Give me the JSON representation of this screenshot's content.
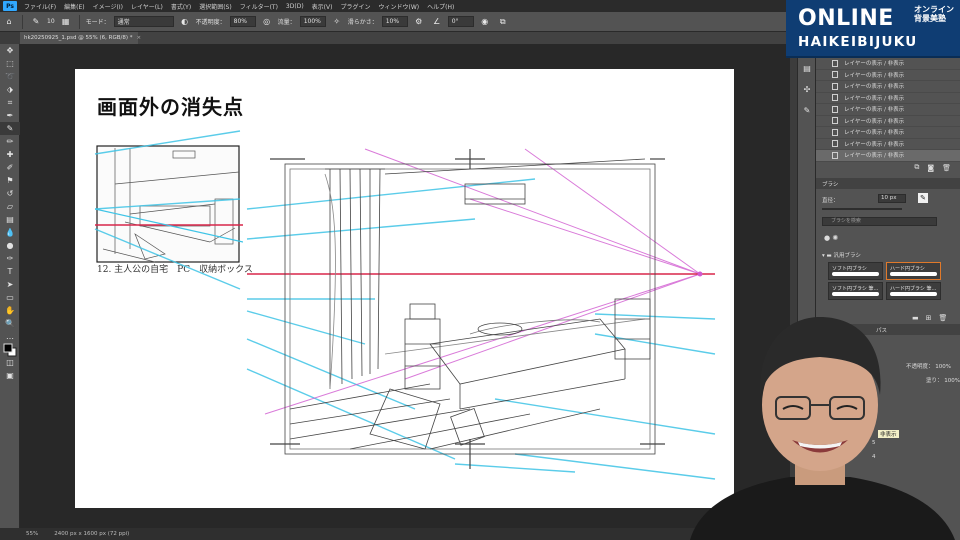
{
  "menu": {
    "app_icon": "Ps",
    "items": [
      "ファイル(F)",
      "編集(E)",
      "イメージ(I)",
      "レイヤー(L)",
      "書式(Y)",
      "選択範囲(S)",
      "フィルター(T)",
      "3D(D)",
      "表示(V)",
      "プラグイン",
      "ウィンドウ(W)",
      "ヘルプ(H)"
    ]
  },
  "options": {
    "brush_size": "10",
    "mode_label": "モード：",
    "mode_value": "通常",
    "opacity_label": "不透明度：",
    "opacity_value": "80%",
    "flow_label": "流量：",
    "flow_value": "100%",
    "smoothing_label": "滑らかさ：",
    "smoothing_value": "10%",
    "angle_value": "0°"
  },
  "document": {
    "tab_title": "hk20250925_1.psd @ 55% (6, RGB/8) *",
    "title": "画面外の消失点",
    "sketch_caption": "12. 主人公の自宅　PC　収納ボックス"
  },
  "status": {
    "zoom": "55%",
    "doc_size": "2400 px x 1600 px (72 ppi)"
  },
  "history": {
    "items": [
      "レイヤーの表示 / 非表示",
      "レイヤーの表示 / 非表示",
      "レイヤーの表示 / 非表示",
      "レイヤーの表示 / 非表示",
      "レイヤーの表示 / 非表示",
      "レイヤーの表示 / 非表示",
      "レイヤーの表示 / 非表示",
      "レイヤーの表示 / 非表示",
      "レイヤーの表示 / 非表示"
    ]
  },
  "brush_panel": {
    "tab": "ブラシ",
    "size_label": "直径：",
    "size_value": "10 px",
    "search_placeholder": "ブラシを検索",
    "group_name": "汎用ブラシ",
    "brushes": [
      "ソフト円ブラシ",
      "ハード円ブラシ",
      "ソフト円ブラシ 筆...",
      "ハード円ブラシ 筆..."
    ]
  },
  "layers_panel": {
    "tab": "パス",
    "opacity_label": "不透明度：",
    "opacity_value": "100%",
    "fill_label": "塗り：",
    "fill_value": "100%",
    "tooltip": "非表示",
    "layer_numbers": [
      "5",
      "4"
    ]
  },
  "logo": {
    "line1": "ONLINE",
    "line1_small": "オンライン背景美塾",
    "line2": "HAIKEIBIJUKU"
  },
  "colors": {
    "accent": "#31a8ff",
    "guide_cyan": "#3fc4e6",
    "guide_magenta": "#d05ad0",
    "guide_red": "#d8264a",
    "logo_bg": "#0f3d73"
  }
}
